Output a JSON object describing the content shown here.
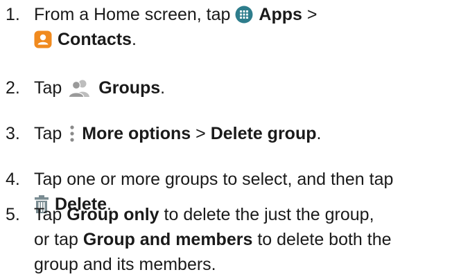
{
  "steps": [
    {
      "number": "1.",
      "lines": [
        {
          "pre": "From a Home screen, tap",
          "icon": "apps-grid-icon",
          "bold": "Apps",
          "post": " >"
        },
        {
          "icon": "contacts-icon",
          "bold": "Contacts",
          "post": "."
        }
      ]
    },
    {
      "number": "2.",
      "lines": [
        {
          "pre": "Tap",
          "icon": "groups-icon",
          "bold": "Groups",
          "post": "."
        }
      ]
    },
    {
      "number": "3.",
      "lines": [
        {
          "pre": "Tap",
          "icon": "more-options-icon",
          "bold": "More options",
          "mid": " > ",
          "bold2": "Delete group",
          "post": "."
        }
      ]
    },
    {
      "number": "4.",
      "lines": [
        {
          "pre": "Tap one or more groups to select, and then tap"
        },
        {
          "icon": "trash-icon",
          "bold": "Delete",
          "post": "."
        }
      ]
    },
    {
      "number": "5.",
      "lines": [
        {
          "pre": "Tap ",
          "bold": "Group only",
          "post": " to delete the just the group,"
        },
        {
          "pre": "or tap ",
          "bold": "Group and members",
          "post": " to delete both the"
        },
        {
          "pre": "group and its members."
        }
      ]
    }
  ],
  "colors": {
    "apps_icon": "#2e7d8c",
    "contacts_icon": "#f08a1f",
    "groups_icon": "#9a9a9a",
    "trash_icon": "#7a8c92",
    "text": "#1a1a1a"
  }
}
